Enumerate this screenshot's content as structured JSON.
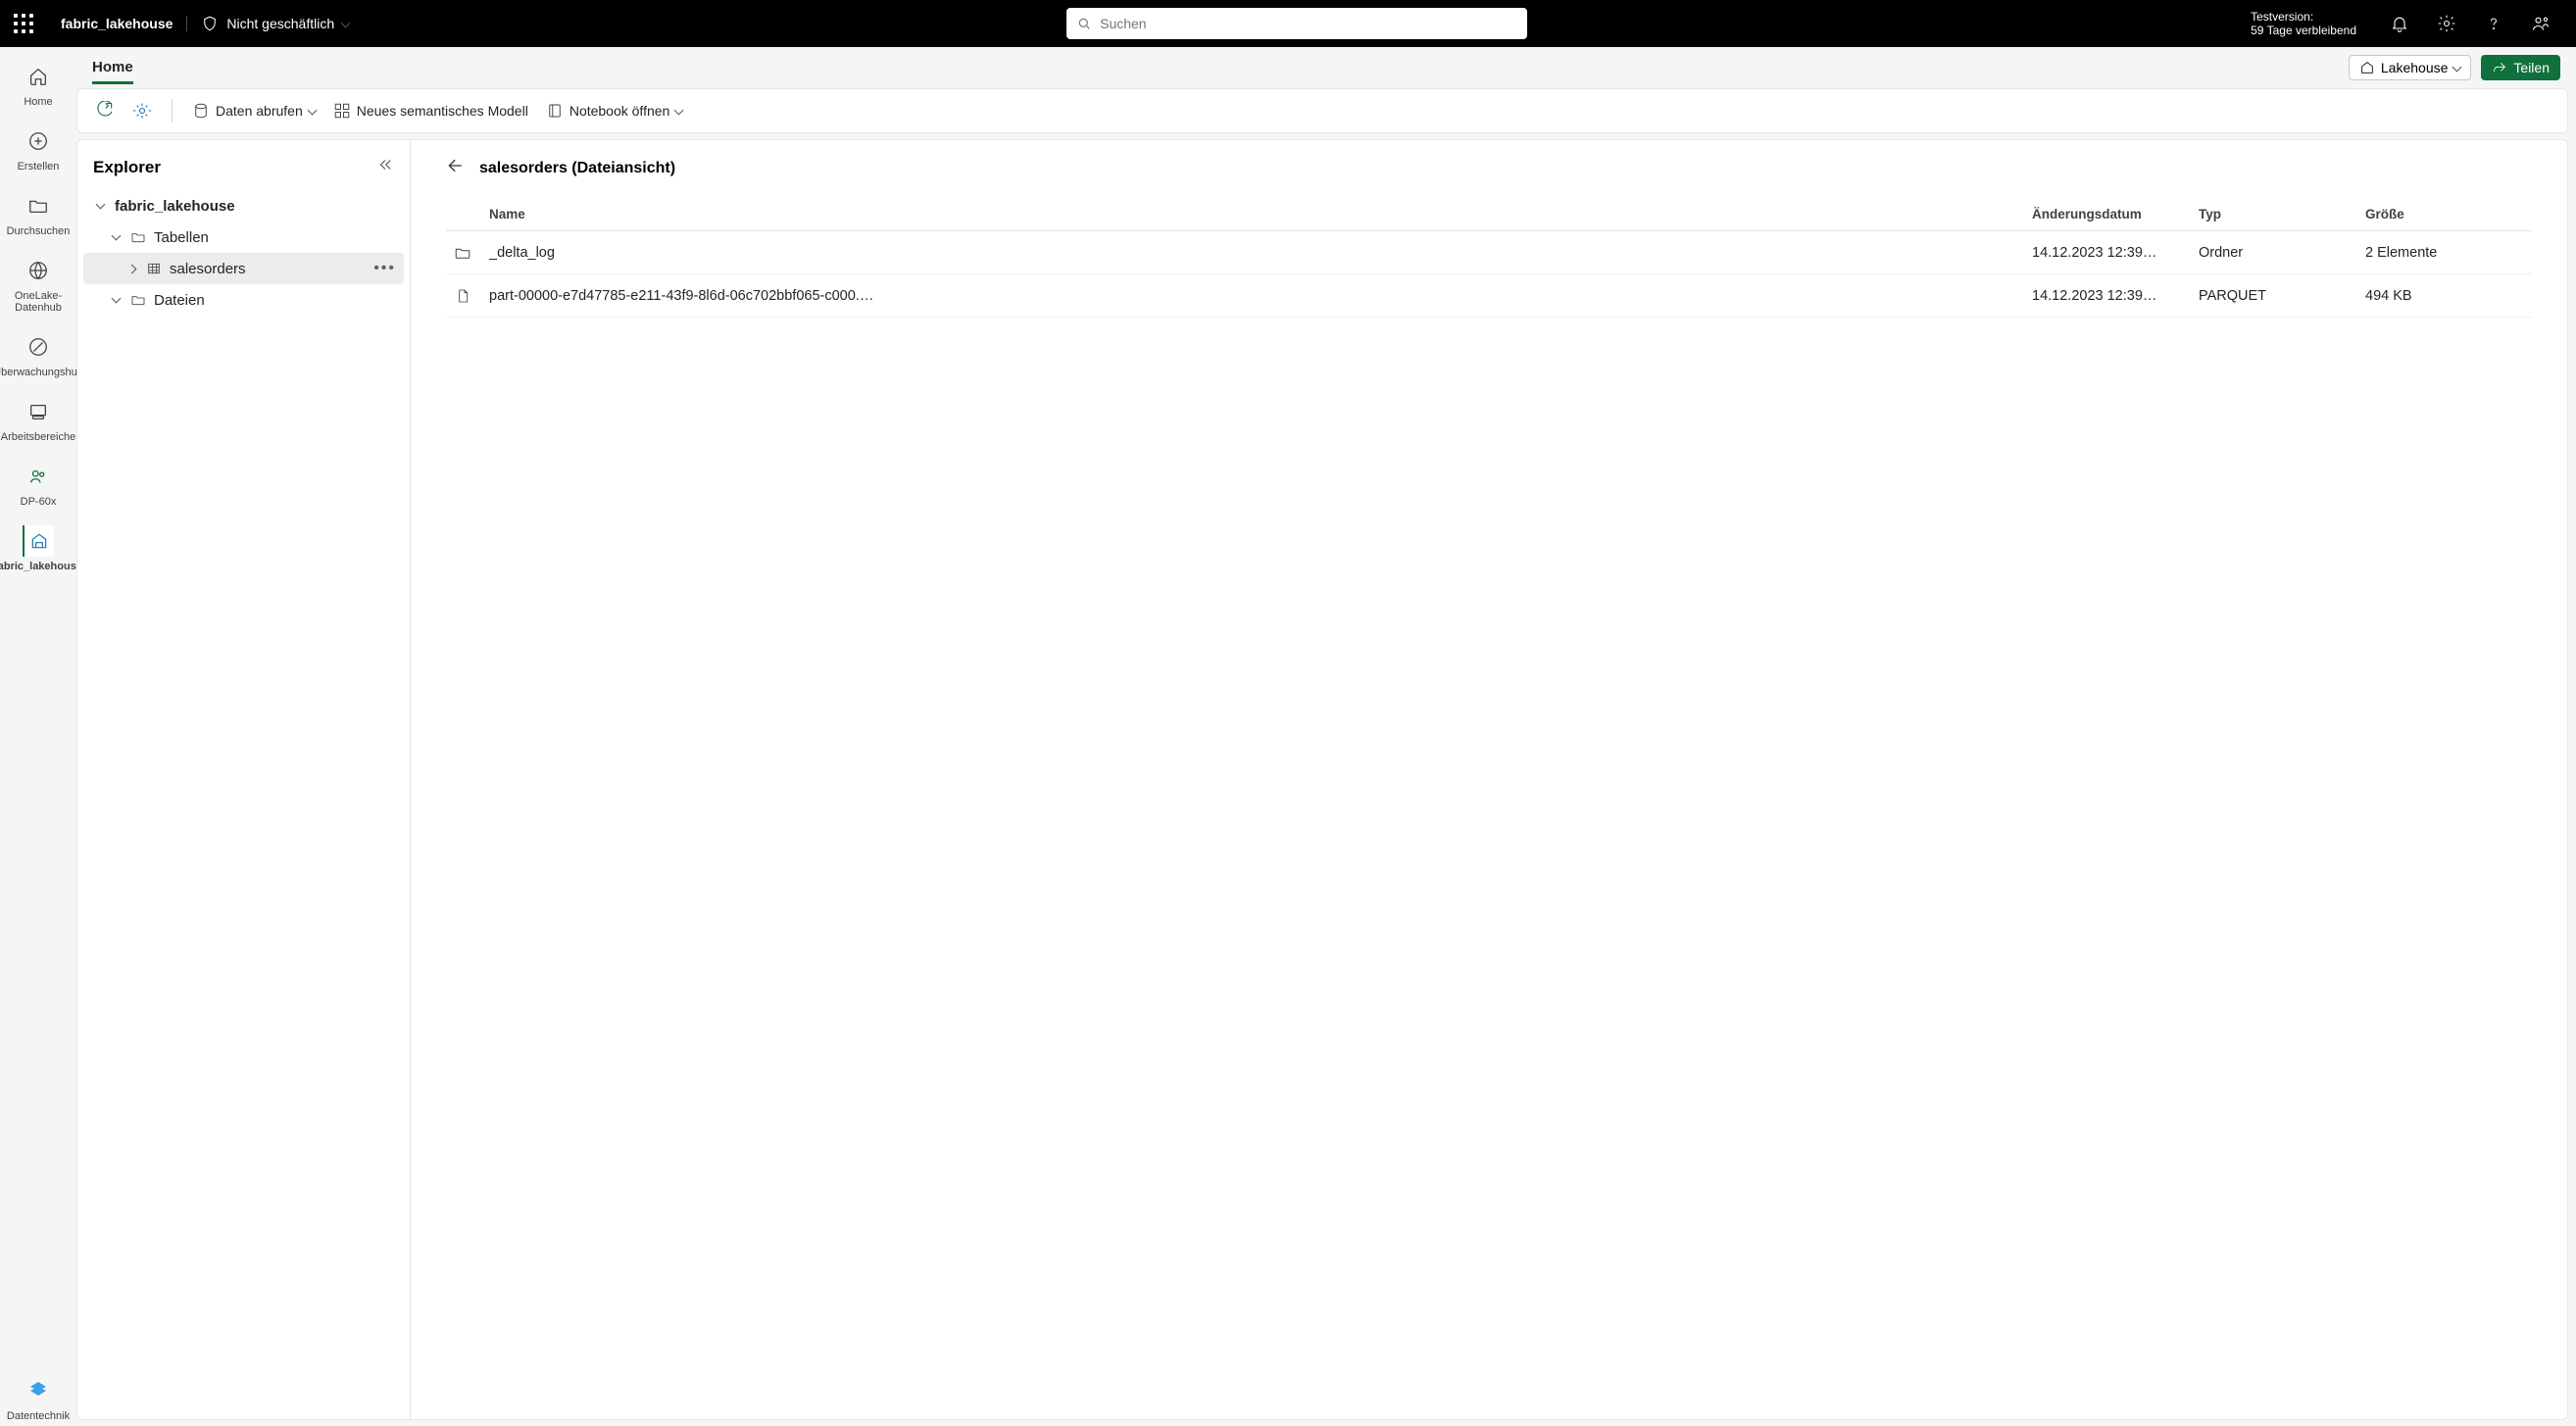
{
  "topbar": {
    "app_name": "fabric_lakehouse",
    "sensitivity_label": "Nicht geschäftlich",
    "search_placeholder": "Suchen",
    "trial_line1": "Testversion:",
    "trial_line2": "59 Tage verbleibend"
  },
  "leftrail": {
    "items": [
      {
        "label": "Home"
      },
      {
        "label": "Erstellen"
      },
      {
        "label": "Durchsuchen"
      },
      {
        "label": "OneLake-Datenhub"
      },
      {
        "label": "Überwachungshub"
      },
      {
        "label": "Arbeitsbereiche"
      },
      {
        "label": "DP-60x"
      },
      {
        "label": "fabric_lakehouse"
      }
    ],
    "bottom_label": "Datentechnik"
  },
  "tabs": {
    "home": "Home"
  },
  "rightpills": {
    "lakehouse": "Lakehouse",
    "share": "Teilen"
  },
  "toolbar": {
    "get_data": "Daten abrufen",
    "new_semantic_model": "Neues semantisches Modell",
    "open_notebook": "Notebook öffnen"
  },
  "explorer": {
    "title": "Explorer",
    "root": "fabric_lakehouse",
    "tables": "Tabellen",
    "salesorders": "salesorders",
    "files": "Dateien"
  },
  "fileview": {
    "title": "salesorders (Dateiansicht)",
    "columns": {
      "name": "Name",
      "modified": "Änderungsdatum",
      "type": "Typ",
      "size": "Größe"
    },
    "rows": [
      {
        "icon": "folder",
        "name": "_delta_log",
        "modified": "14.12.2023 12:39…",
        "type": "Ordner",
        "size": "2 Elemente"
      },
      {
        "icon": "file",
        "name": "part-00000-e7d47785-e211-43f9-8l6d-06c702bbf065-c000.…",
        "modified": "14.12.2023 12:39…",
        "type": "PARQUET",
        "size": "494 KB"
      }
    ]
  }
}
